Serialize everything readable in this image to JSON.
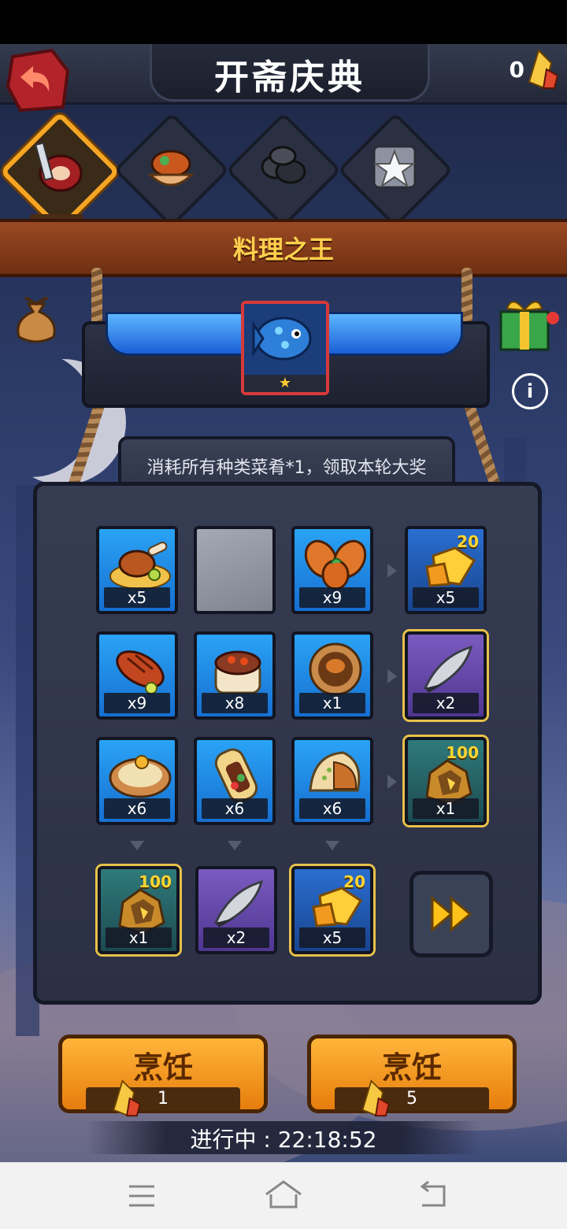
{
  "header": {
    "title": "开斋庆典",
    "currency_count": "0"
  },
  "tabs": [
    {
      "label": "料理",
      "icon": "meat-cleaver-icon",
      "active": true
    },
    {
      "label": "宴请",
      "icon": "feast-icon",
      "active": false
    },
    {
      "label": "椰枣",
      "icon": "dates-icon",
      "active": false
    },
    {
      "label": "好运",
      "icon": "star-trophy-icon",
      "active": false
    }
  ],
  "banner": {
    "title": "料理之王"
  },
  "grand_prize": {
    "icon": "blue-fish-icon",
    "stars": "★"
  },
  "board": {
    "description": "消耗所有种类菜肴*1，领取本轮大奖",
    "rows": [
      {
        "cells": [
          {
            "icon": "roast-chicken-icon",
            "qty": "x5"
          },
          {
            "icon": "empty-slot",
            "qty": ""
          },
          {
            "icon": "leaf-dish-icon",
            "qty": "x9"
          }
        ],
        "reward": {
          "icon": "gem-icon",
          "qty": "x5",
          "badge": "20"
        }
      },
      {
        "cells": [
          {
            "icon": "grilled-fish-icon",
            "qty": "x9"
          },
          {
            "icon": "rice-cake-icon",
            "qty": "x8"
          },
          {
            "icon": "stew-plate-icon",
            "qty": "x1"
          }
        ],
        "reward": {
          "icon": "feather-icon",
          "qty": "x2",
          "badge": ""
        }
      },
      {
        "cells": [
          {
            "icon": "noodle-plate-icon",
            "qty": "x6"
          },
          {
            "icon": "wrap-icon",
            "qty": "x6"
          },
          {
            "icon": "samosa-icon",
            "qty": "x6"
          }
        ],
        "reward": {
          "icon": "ore-chest-icon",
          "qty": "x1",
          "badge": "100"
        }
      }
    ],
    "column_rewards": [
      {
        "icon": "ore-chest-icon",
        "qty": "x1",
        "badge": "100"
      },
      {
        "icon": "feather-icon",
        "qty": "x2",
        "badge": ""
      },
      {
        "icon": "gem-icon",
        "qty": "x5",
        "badge": "20"
      }
    ]
  },
  "cook_buttons": [
    {
      "label": "烹饪",
      "cost": "1"
    },
    {
      "label": "烹饪",
      "cost": "5"
    }
  ],
  "timer": "进行中 : 22:18:52",
  "colors": {
    "accent": "#f5a623",
    "banner": "#8a3e1c",
    "cell_blue": "#1f8be6",
    "cook_orange": "#f39a1f"
  }
}
